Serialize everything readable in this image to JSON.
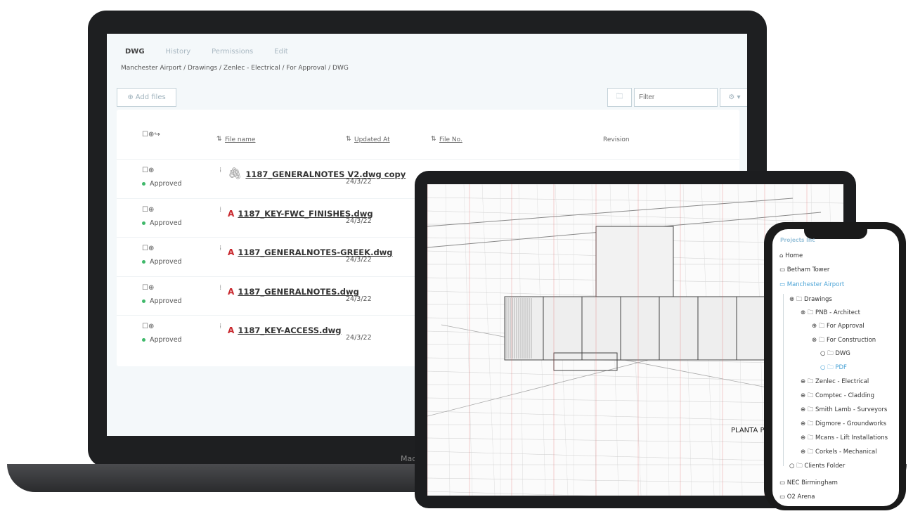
{
  "laptop": {
    "tabs": [
      "DWG",
      "History",
      "Permissions",
      "Edit"
    ],
    "breadcrumb": "Manchester Airport / Drawings / Zenlec - Electrical / For Approval / DWG",
    "add_files": "Add files",
    "filter_placeholder": "Filter",
    "brand": "Mac",
    "headers": {
      "file_name": "File name",
      "updated_at": "Updated At",
      "file_no": "File No.",
      "revision": "Revision"
    },
    "rows": [
      {
        "name": "1187_GENERALNOTES V2.dwg copy",
        "status": "Approved",
        "date": "24/3/22",
        "icon": "paperclip-icon"
      },
      {
        "name": "1187_KEY-FWC_FINISHES.dwg",
        "status": "Approved",
        "date": "24/3/22",
        "icon": "autocad-icon"
      },
      {
        "name": "1187_GENERALNOTES-GREEK.dwg",
        "status": "Approved",
        "date": "24/3/22",
        "icon": "autocad-icon"
      },
      {
        "name": "1187_GENERALNOTES.dwg",
        "status": "Approved",
        "date": "24/3/22",
        "icon": "autocad-icon"
      },
      {
        "name": "1187_KEY-ACCESS.dwg",
        "status": "Approved",
        "date": "24/3/22",
        "icon": "autocad-icon"
      }
    ],
    "status_color": "#3fb86a"
  },
  "tablet": {
    "drawing_label": "PLANTA PIS"
  },
  "phone": {
    "org": "Projects Inc",
    "tree": [
      {
        "label": "Home",
        "level": 0,
        "icon": "home-icon"
      },
      {
        "label": "Betham Tower",
        "level": 0,
        "icon": "briefcase-icon"
      },
      {
        "label": "Manchester Airport",
        "level": 0,
        "icon": "briefcase-icon",
        "active": true
      },
      {
        "label": "Drawings",
        "level": 1,
        "toggle": "collapse"
      },
      {
        "label": "PNB - Architect",
        "level": 2,
        "toggle": "collapse"
      },
      {
        "label": "For Approval",
        "level": 3,
        "toggle": "expand"
      },
      {
        "label": "For Construction",
        "level": 3,
        "toggle": "collapse"
      },
      {
        "label": "DWG",
        "level": 4,
        "toggle": "none"
      },
      {
        "label": "PDF",
        "level": 4,
        "toggle": "none",
        "active": true
      },
      {
        "label": "Zenlec - Electrical",
        "level": 2,
        "toggle": "expand"
      },
      {
        "label": "Comptec - Cladding",
        "level": 2,
        "toggle": "expand"
      },
      {
        "label": "Smith Lamb - Surveyors",
        "level": 2,
        "toggle": "expand"
      },
      {
        "label": "Digmore - Groundworks",
        "level": 2,
        "toggle": "expand"
      },
      {
        "label": "Mcans - Lift Installations",
        "level": 2,
        "toggle": "expand"
      },
      {
        "label": "Corkels - Mechanical",
        "level": 2,
        "toggle": "expand"
      },
      {
        "label": "Clients Folder",
        "level": 1,
        "toggle": "none"
      },
      {
        "label": "NEC Birmingham",
        "level": 0,
        "icon": "briefcase-icon"
      },
      {
        "label": "O2 Arena",
        "level": 0,
        "icon": "briefcase-icon"
      }
    ],
    "accent": "#4aa3d6"
  }
}
